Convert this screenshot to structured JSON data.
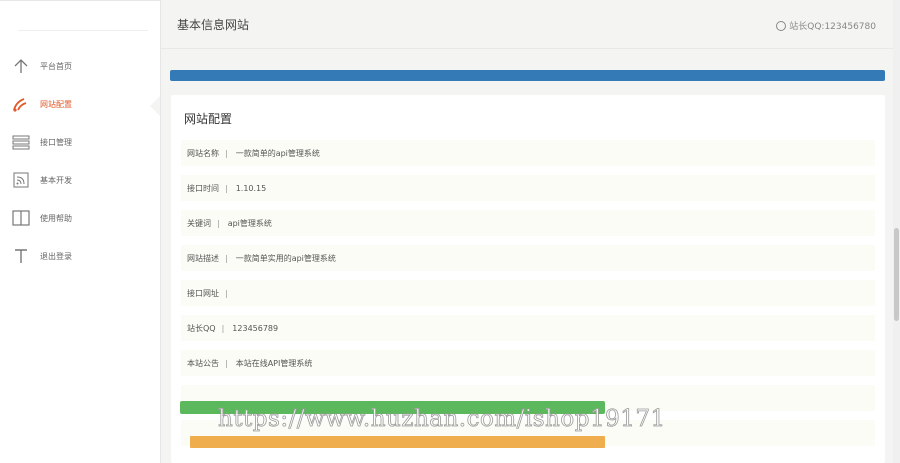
{
  "header": {
    "title": "基本信息网站",
    "contact": "站长QQ:123456780"
  },
  "sidebar": {
    "items": [
      {
        "label": "平台首页",
        "icon": "arrow-up-icon",
        "active": false
      },
      {
        "label": "网站配置",
        "icon": "rss-feed-icon",
        "active": true
      },
      {
        "label": "接口管理",
        "icon": "list-icon",
        "active": false
      },
      {
        "label": "基本开发",
        "icon": "rss-icon",
        "active": false
      },
      {
        "label": "使用帮助",
        "icon": "book-icon",
        "active": false
      },
      {
        "label": "退出登录",
        "icon": "text-icon",
        "active": false
      }
    ]
  },
  "panel": {
    "title": "网站配置",
    "rows": [
      {
        "key": "网站名称",
        "value": "一款简单的api管理系统"
      },
      {
        "key": "接口时间",
        "value": "1.10.15"
      },
      {
        "key": "关键词",
        "value": "api管理系统"
      },
      {
        "key": "网站描述",
        "value": "一款简单实用的api管理系统"
      },
      {
        "key": "接口网址",
        "value": ""
      },
      {
        "key": "站长QQ",
        "value": "123456789"
      },
      {
        "key": "本站公告",
        "value": "本站在线API管理系统"
      }
    ]
  },
  "watermark": "https://www.huzhan.com/ishop19171",
  "colors": {
    "primary": "#337ab7",
    "success": "#5cb85c",
    "warning": "#f0ad4e",
    "active": "#e05a2b"
  }
}
